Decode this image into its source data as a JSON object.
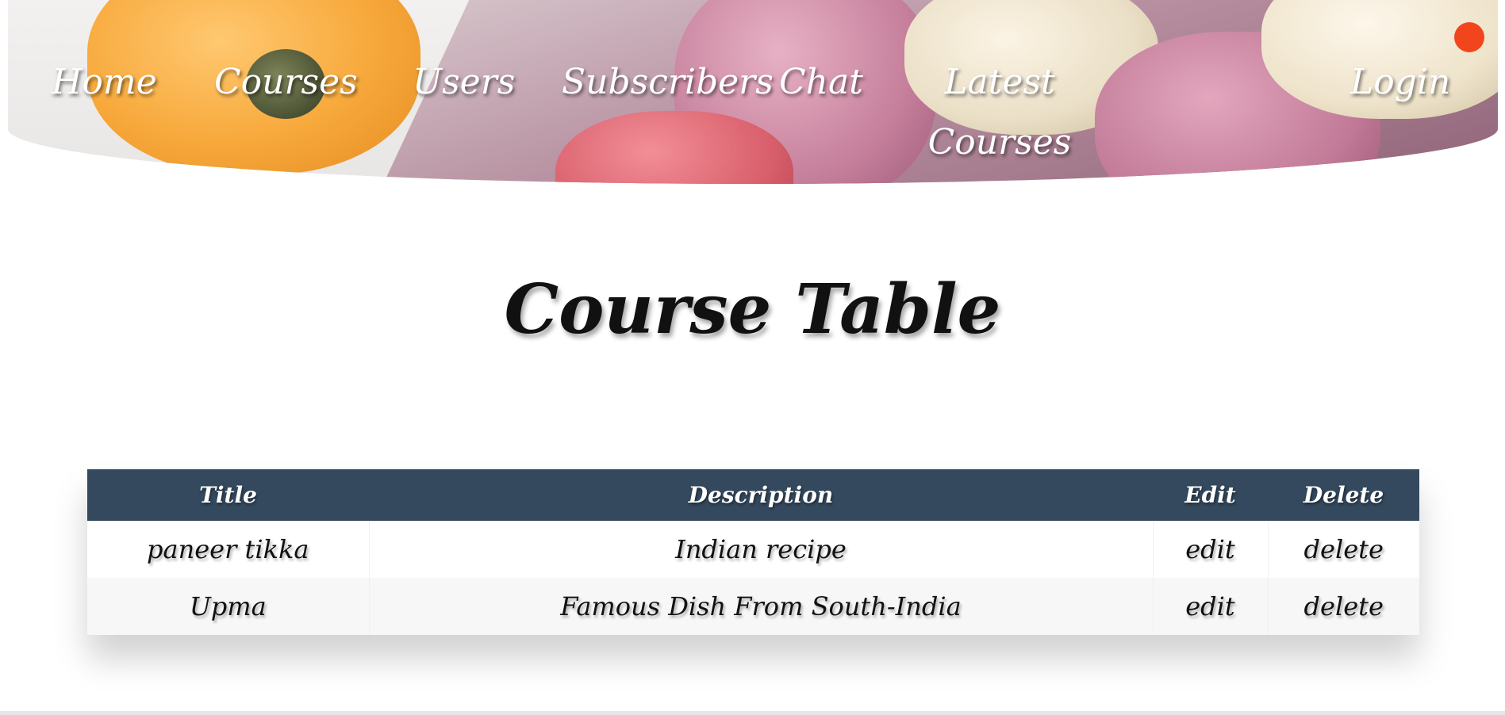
{
  "nav": {
    "items": [
      {
        "label": "Home"
      },
      {
        "label": "Courses"
      },
      {
        "label": "Users"
      },
      {
        "label": "Subscribers"
      },
      {
        "label": "Chat"
      },
      {
        "label": "Latest Courses"
      },
      {
        "label": "Login"
      }
    ]
  },
  "main": {
    "title": "Course Table"
  },
  "table": {
    "headers": [
      "Title",
      "Description",
      "Edit",
      "Delete"
    ],
    "rows": [
      {
        "title": "paneer tikka",
        "description": "Indian recipe",
        "edit": "edit",
        "delete": "delete"
      },
      {
        "title": "Upma",
        "description": "Famous Dish From South-India",
        "edit": "edit",
        "delete": "delete"
      }
    ]
  },
  "colors": {
    "header_bg": "#34495e",
    "notification": "#f2451c"
  }
}
